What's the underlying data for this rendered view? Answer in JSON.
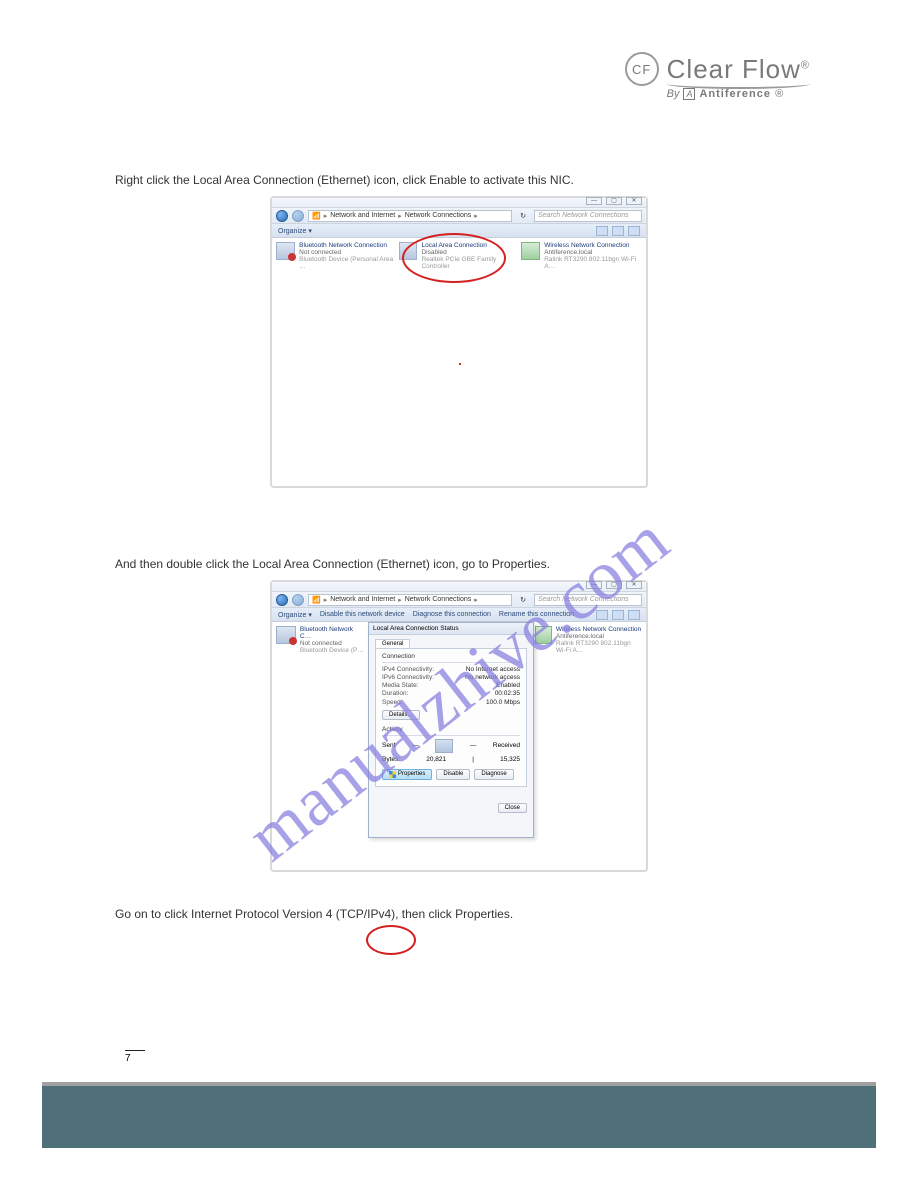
{
  "logo": {
    "badge": "CF",
    "name": "Clear Flow",
    "reg": "®",
    "by": "By",
    "brand": "Antiference",
    "brand_reg": "®"
  },
  "watermark": "manualzhive.com",
  "paragraphs": {
    "p1": "Right click the Local Area Connection (Ethernet) icon, click Enable to activate this NIC.",
    "p2": "And then double click the Local Area Connection (Ethernet) icon, go to Properties.",
    "p3": "Go on to click Internet Protocol Version 4 (TCP/IPv4), then click Properties."
  },
  "window": {
    "controls": {
      "min": "—",
      "max": "▢",
      "close": "✕"
    },
    "breadcrumb": {
      "root": "Network and Internet",
      "current": "Network Connections",
      "sep": "▸"
    },
    "refresh_icon": "↻",
    "search_icon": "🔍",
    "search_placeholder": "Search Network Connections",
    "organize": "Organize ▾",
    "toolbar2": {
      "disable": "Disable this network device",
      "diagnose": "Diagnose this connection",
      "rename": "Rename this connection"
    },
    "view_icon": "≡",
    "help_icon": "?",
    "connections": {
      "bluetooth": {
        "title": "Bluetooth Network Connection",
        "line2": "Not connected",
        "line3": "Bluetooth Device (Personal Area …"
      },
      "lan": {
        "title": "Local Area Connection",
        "line2": "Disabled",
        "line3": "Realtek PCIe GBE Family Controller"
      },
      "wifi": {
        "title": "Wireless Network Connection",
        "line2": "Antiference.local",
        "line3": "Ralink RT3290 802.11bgn Wi-Fi A…"
      }
    }
  },
  "status_dialog": {
    "title": "Local Area Connection Status",
    "tab": "General",
    "group_connection": "Connection",
    "rows": {
      "ipv4_k": "IPv4 Connectivity:",
      "ipv4_v": "No Internet access",
      "ipv6_k": "IPv6 Connectivity:",
      "ipv6_v": "No network access",
      "media_k": "Media State:",
      "media_v": "Enabled",
      "dur_k": "Duration:",
      "dur_v": "00:02:35",
      "speed_k": "Speed:",
      "speed_v": "100.0 Mbps"
    },
    "details_btn": "Details…",
    "group_activity": "Activity",
    "sent": "Sent",
    "received": "Received",
    "bytes_label": "Bytes:",
    "sent_val": "20,821",
    "recv_val": "15,325",
    "props_btn": "Properties",
    "disable_btn": "Disable",
    "diagnose_btn": "Diagnose",
    "close_btn": "Close"
  },
  "page_number": "7"
}
